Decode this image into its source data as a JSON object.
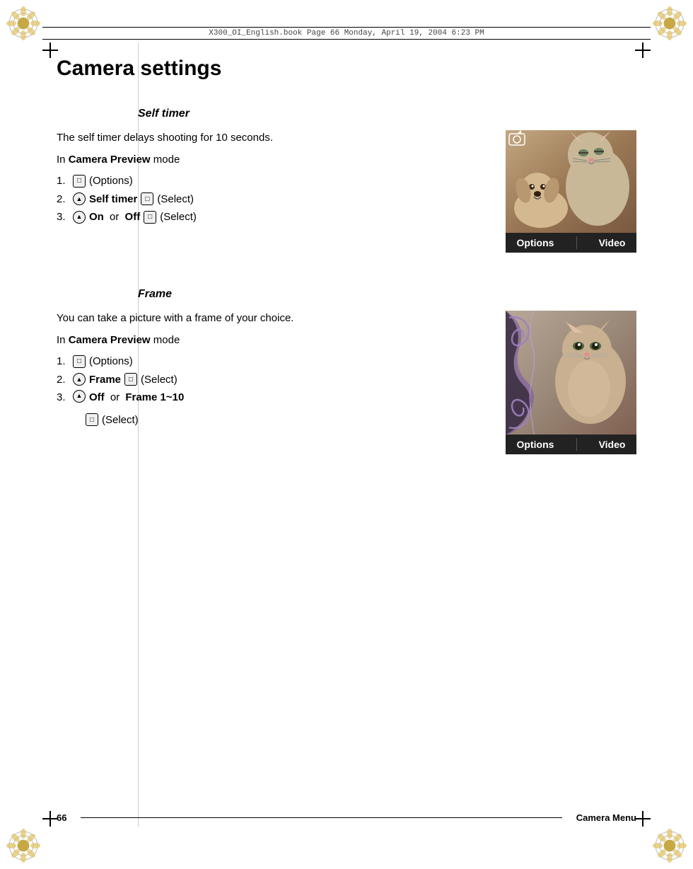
{
  "header": {
    "text": "X300_OI_English.book   Page 66   Monday, April 19, 2004   6:23 PM"
  },
  "page": {
    "title": "Camera settings",
    "footer_page_num": "66",
    "footer_title": "Camera Menu"
  },
  "self_timer_section": {
    "heading": "Self timer",
    "description": "The self timer delays shooting for 10 seconds.",
    "mode_label": "In ",
    "mode_bold": "Camera Preview",
    "mode_suffix": " mode",
    "steps": [
      {
        "num": "1.",
        "btn_type": "square",
        "btn_label": "□",
        "text": "(Options)"
      },
      {
        "num": "2.",
        "nav_type": "round",
        "nav_label": "↑",
        "bold_text": "Self timer",
        "btn_type": "square",
        "btn_label": "□",
        "text2": "(Select)"
      },
      {
        "num": "3.",
        "nav_type": "round",
        "nav_label": "↑",
        "bold_text": "On",
        "text_middle": " or ",
        "bold_text2": "Off",
        "btn_type": "square",
        "btn_label": "□",
        "text2": "(Select)"
      }
    ],
    "preview_bar": {
      "left": "Options",
      "right": "Video"
    }
  },
  "frame_section": {
    "heading": "Frame",
    "description": "You can take a picture with a frame of your choice.",
    "mode_label": "In ",
    "mode_bold": "Camera Preview",
    "mode_suffix": " mode",
    "steps": [
      {
        "num": "1.",
        "btn_type": "square",
        "text": "(Options)"
      },
      {
        "num": "2.",
        "nav_type": "round",
        "nav_label": "↑",
        "bold_text": "Frame",
        "text2": "(Select)"
      },
      {
        "num": "3.",
        "nav_type": "round",
        "nav_label": "↑",
        "bold_text": "Off",
        "text_middle": " or ",
        "bold_text2": "Frame 1~10",
        "text3": "(Select)"
      }
    ],
    "preview_bar": {
      "left": "Options",
      "right": "Video"
    }
  }
}
